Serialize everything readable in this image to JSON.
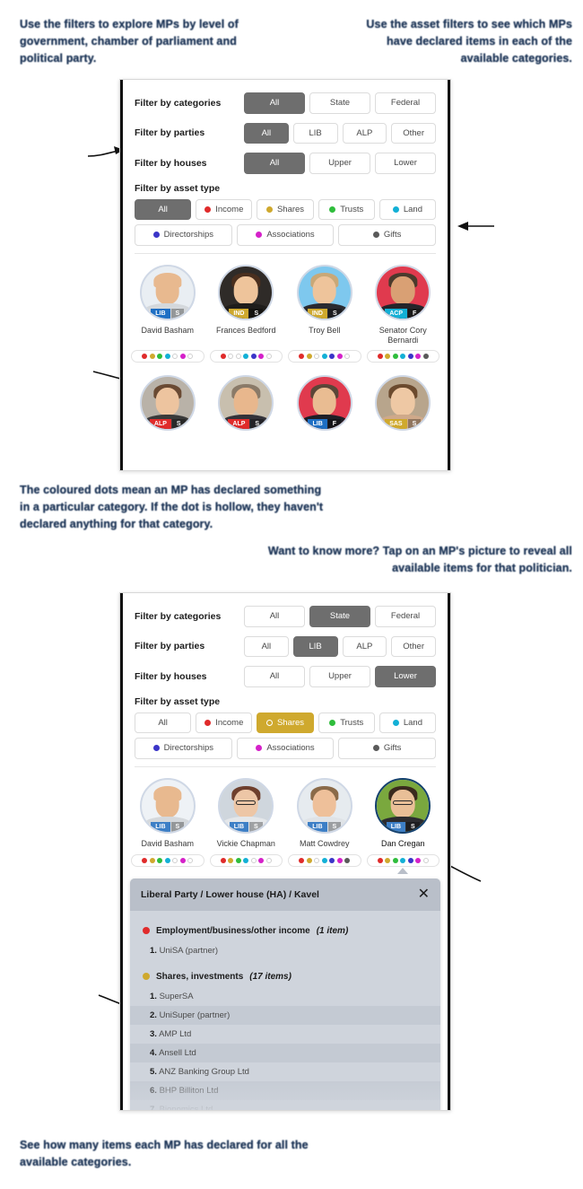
{
  "annotations": {
    "top_left": "Use the filters to explore MPs by level of government, chamber of parliament and political party.",
    "top_right": "Use the asset filters to see which MPs have declared items in each of the available categories.",
    "mid_left": "The coloured dots mean an MP has declared something in a particular category. If the dot is hollow, they haven't declared anything for that category.",
    "mid_right": "Want to know more? Tap on an MP's picture to reveal all available items for that politician.",
    "bottom_left": "See how many items each MP has declared for all the available categories."
  },
  "colors": {
    "annotation_blue": "#1d3557",
    "selected_grey": "#6e6e6e",
    "selected_gold": "#cfa92e",
    "income": "#e02b2b",
    "shares": "#cfa92e",
    "trusts": "#2fbd3c",
    "land": "#13b0d6",
    "directorships": "#3b35c8",
    "associations": "#d521c9",
    "gifts": "#5a5a5a"
  },
  "asset_categories": [
    {
      "key": "income",
      "label": "Income",
      "color": "#e02b2b"
    },
    {
      "key": "shares",
      "label": "Shares",
      "color": "#cfa92e"
    },
    {
      "key": "trusts",
      "label": "Trusts",
      "color": "#2fbd3c"
    },
    {
      "key": "land",
      "label": "Land",
      "color": "#13b0d6"
    },
    {
      "key": "directorships",
      "label": "Directorships",
      "color": "#3b35c8"
    },
    {
      "key": "associations",
      "label": "Associations",
      "color": "#d521c9"
    },
    {
      "key": "gifts",
      "label": "Gifts",
      "color": "#5a5a5a"
    }
  ],
  "panel1": {
    "filters": {
      "categories": {
        "label": "Filter by categories",
        "options": [
          "All",
          "State",
          "Federal"
        ],
        "selected": "All"
      },
      "parties": {
        "label": "Filter by parties",
        "options": [
          "All",
          "LIB",
          "ALP",
          "Other"
        ],
        "selected": "All"
      },
      "houses": {
        "label": "Filter by houses",
        "options": [
          "All",
          "Upper",
          "Lower"
        ],
        "selected": "All"
      },
      "asset_type": {
        "label": "Filter by asset type",
        "all_label": "All",
        "selected": "All"
      }
    },
    "mps": [
      {
        "name": "David Basham",
        "party": "LIB",
        "party_color": "#1e6fc4",
        "house": "S",
        "dots": [
          true,
          true,
          true,
          true,
          false,
          true,
          false
        ],
        "bg": "#e9eef3",
        "skin": "#e8b98f",
        "hair": "#e8b98f",
        "body": "#d4d8dc",
        "glasses": false
      },
      {
        "name": "Frances Bedford",
        "party": "IND",
        "party_color": "#cfa92e",
        "house": "S",
        "dots": [
          true,
          false,
          false,
          true,
          true,
          true,
          false
        ],
        "bg": "#2f2b28",
        "skin": "#eec49b",
        "hair": "#4a2f1e",
        "body": "#1f1d1b",
        "glasses": false
      },
      {
        "name": "Troy Bell",
        "party": "IND",
        "party_color": "#cfa92e",
        "house": "S",
        "dots": [
          true,
          true,
          false,
          true,
          true,
          true,
          false
        ],
        "bg": "#7ec8ee",
        "skin": "#eec49b",
        "hair": "#c9a877",
        "body": "#2a2a30",
        "glasses": false
      },
      {
        "name": "Senator Cory Bernardi",
        "party": "ACP",
        "party_color": "#13b0d6",
        "house": "F",
        "dots": [
          true,
          true,
          true,
          true,
          true,
          true,
          true
        ],
        "bg": "#e03a4e",
        "skin": "#d9a074",
        "hair": "#4a3a2c",
        "body": "#24242a",
        "glasses": false
      }
    ],
    "mps_row2": [
      {
        "party": "ALP",
        "party_color": "#e02b2b",
        "house": "S",
        "bg": "#b9b2a8",
        "skin": "#edc49f",
        "hair": "#6a4a33",
        "body": "#3a3a3a",
        "glasses": false
      },
      {
        "party": "ALP",
        "party_color": "#e02b2b",
        "house": "S",
        "bg": "#c8bfae",
        "skin": "#e8b78d",
        "hair": "#8a7a68",
        "body": "#33333a",
        "glasses": false
      },
      {
        "party": "LIB",
        "party_color": "#1e6fc4",
        "house": "F",
        "bg": "#e03a4e",
        "skin": "#e9bc92",
        "hair": "#5a4738",
        "body": "#1f1f26",
        "glasses": false
      },
      {
        "party": "SAS",
        "party_color": "#cfa92e",
        "house": "S",
        "bg": "#b8a58c",
        "skin": "#eec8a4",
        "hair": "#6b4a2e",
        "body": "#cfa98a",
        "glasses": false
      }
    ]
  },
  "panel2": {
    "filters": {
      "categories": {
        "label": "Filter by categories",
        "options": [
          "All",
          "State",
          "Federal"
        ],
        "selected": "State"
      },
      "parties": {
        "label": "Filter by parties",
        "options": [
          "All",
          "LIB",
          "ALP",
          "Other"
        ],
        "selected": "LIB"
      },
      "houses": {
        "label": "Filter by houses",
        "options": [
          "All",
          "Upper",
          "Lower"
        ],
        "selected": "Lower"
      },
      "asset_type": {
        "label": "Filter by asset type",
        "all_label": "All",
        "selected": "Shares"
      }
    },
    "mps": [
      {
        "name": "David Basham",
        "party": "LIB",
        "party_color": "#3d7fc6",
        "house": "S",
        "selected": false,
        "dots": [
          true,
          true,
          true,
          true,
          false,
          true,
          false
        ],
        "bg": "#eef2f6",
        "skin": "#e8b98f",
        "hair": "#e8b98f",
        "body": "#d4d8dc",
        "glasses": false
      },
      {
        "name": "Vickie Chapman",
        "party": "LIB",
        "party_color": "#3d7fc6",
        "house": "S",
        "selected": false,
        "dots": [
          true,
          true,
          true,
          true,
          false,
          true,
          false
        ],
        "bg": "#cfd6dd",
        "skin": "#edc6a6",
        "hair": "#6e3f2c",
        "body": "#e4e7ea",
        "glasses": true
      },
      {
        "name": "Matt Cowdrey",
        "party": "LIB",
        "party_color": "#3d7fc6",
        "house": "S",
        "selected": false,
        "dots": [
          true,
          true,
          false,
          true,
          true,
          true,
          true
        ],
        "bg": "#e6ebef",
        "skin": "#eec09a",
        "hair": "#8a6a48",
        "body": "#dfe3e7",
        "glasses": false
      },
      {
        "name": "Dan Cregan",
        "party": "LIB",
        "party_color": "#3d7fc6",
        "house": "S",
        "selected": true,
        "dots": [
          true,
          true,
          true,
          true,
          true,
          true,
          false
        ],
        "bg": "#7aa83e",
        "skin": "#e9bf97",
        "hair": "#3a2a1e",
        "body": "#2c2c30",
        "glasses": true
      }
    ],
    "popup": {
      "title": "Liberal Party / Lower house (HA) / Kavel",
      "close_label": "✕",
      "sections": [
        {
          "dot_color": "#e02b2b",
          "heading": "Employment/business/other income",
          "count": "(1 item)",
          "items": [
            "UniSA (partner)"
          ]
        },
        {
          "dot_color": "#cfa92e",
          "heading": "Shares, investments",
          "count": "(17 items)",
          "items": [
            "SuperSA",
            "UniSuper (partner)",
            "AMP Ltd",
            "Ansell Ltd",
            "ANZ Banking Group Ltd",
            "BHP Billiton Ltd",
            "Bionomics Ltd"
          ]
        }
      ]
    }
  }
}
